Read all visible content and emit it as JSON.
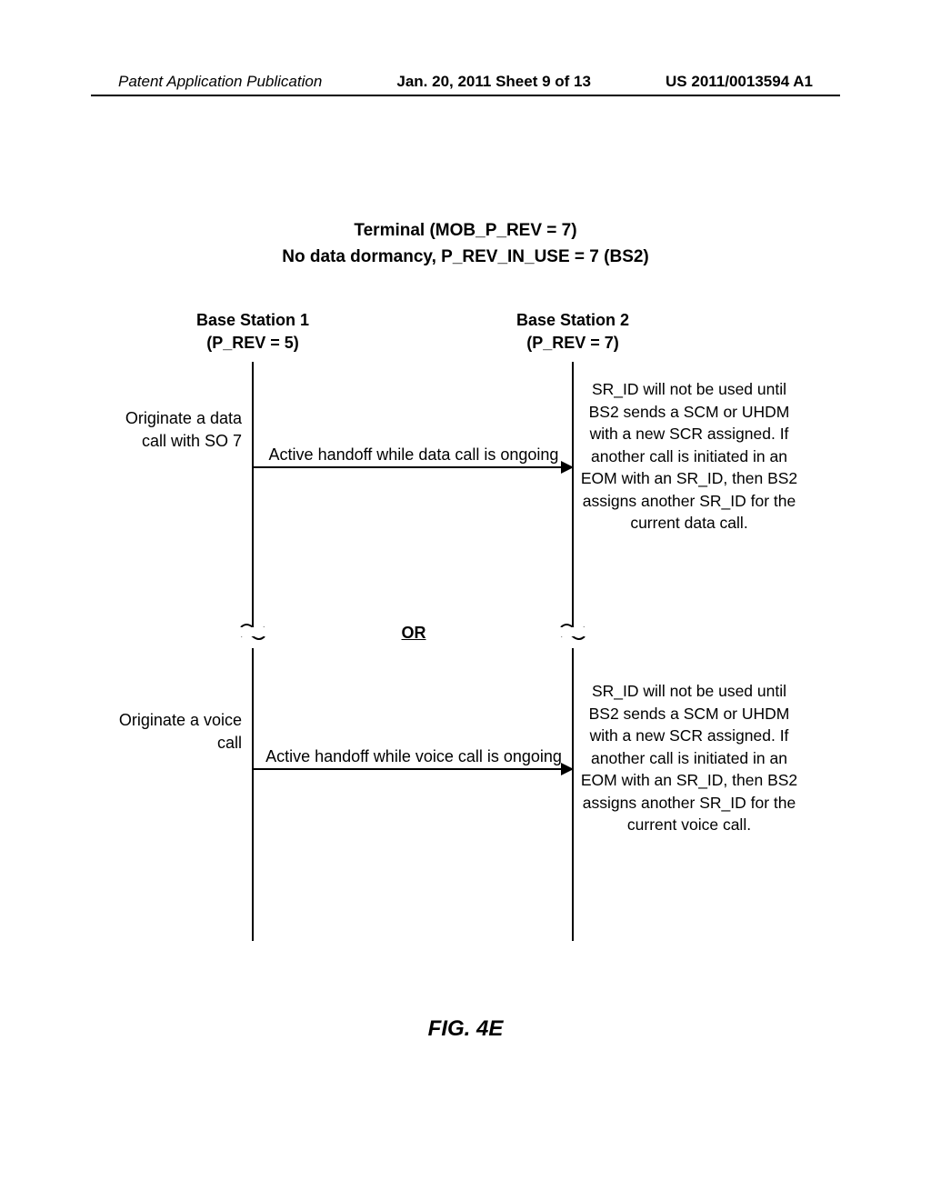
{
  "header": {
    "left": "Patent Application Publication",
    "center": "Jan. 20, 2011  Sheet 9 of 13",
    "right": "US 2011/0013594 A1"
  },
  "title": {
    "line1": "Terminal (MOB_P_REV = 7)",
    "line2": "No data dormancy, P_REV_IN_USE = 7 (BS2)"
  },
  "bs1": {
    "name": "Base Station 1",
    "rev": "(P_REV = 5)"
  },
  "bs2": {
    "name": "Base Station 2",
    "rev": "(P_REV = 7)"
  },
  "scenario1": {
    "left": "Originate a data call with SO 7",
    "arrow": "Active handoff while data call is ongoing",
    "right": "SR_ID will not be used until BS2 sends a SCM or UHDM with a new SCR assigned. If another call is initiated in an EOM with an SR_ID, then BS2 assigns another SR_ID for the current data call."
  },
  "or_label": "OR",
  "scenario2": {
    "left": "Originate a voice call",
    "arrow": "Active handoff while voice call is ongoing",
    "right": "SR_ID will not be used until BS2 sends a SCM or UHDM with a new SCR assigned. If another call is initiated in an EOM with an SR_ID, then BS2 assigns another SR_ID for the current voice call."
  },
  "figure_label": "FIG. 4E"
}
